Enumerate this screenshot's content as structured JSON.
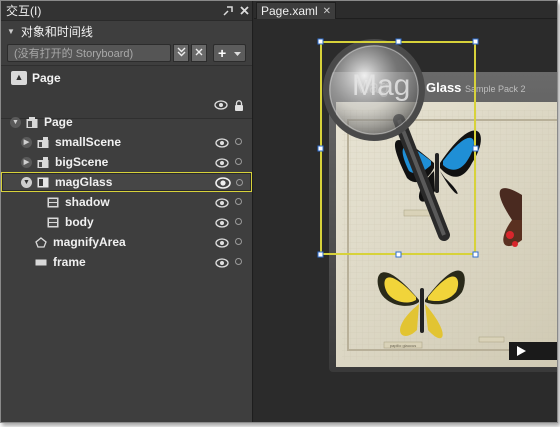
{
  "panel": {
    "title": "交互(I)",
    "section_title": "对象和时间线",
    "storyboard_placeholder": "(没有打开的 Storyboard)",
    "add_label": "+",
    "scope_label": "Page"
  },
  "tree": [
    {
      "label": "Page",
      "icon": "page-icon"
    },
    {
      "label": "smallScene",
      "icon": "canvas-icon"
    },
    {
      "label": "bigScene",
      "icon": "canvas-icon"
    },
    {
      "label": "magGlass",
      "icon": "canvas-icon",
      "selected": true
    },
    {
      "label": "shadow",
      "icon": "shape-icon"
    },
    {
      "label": "body",
      "icon": "shape-icon"
    },
    {
      "label": "magnifyArea",
      "icon": "ellipse-icon"
    },
    {
      "label": "frame",
      "icon": "rectangle-icon"
    }
  ],
  "document": {
    "tab_label": "Page.xaml",
    "header_brand_prefix": "Mag",
    "header_brand_suffix": "Glass",
    "header_sub": "Sample Pack 2",
    "card_label": "papilio glaucus"
  },
  "colors": {
    "selection": "#d7d23a",
    "handle": "#2f6fd0",
    "canvas_bg": "#2b2b2b"
  }
}
